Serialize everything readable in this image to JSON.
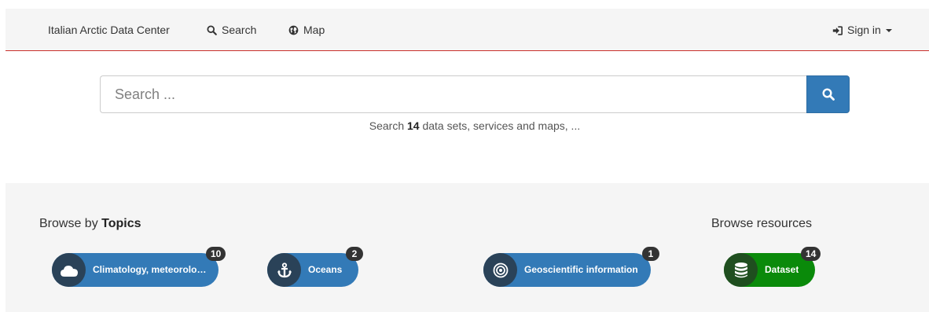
{
  "navbar": {
    "brand": "Italian Arctic Data Center",
    "search_label": "Search",
    "map_label": "Map",
    "signin_label": "Sign in"
  },
  "search": {
    "placeholder": "Search ...",
    "hint_prefix": "Search ",
    "hint_count": "14",
    "hint_suffix": " data sets, services and maps, ..."
  },
  "browse": {
    "topics_prefix": "Browse by ",
    "topics_bold": "Topics",
    "resources_title": "Browse resources",
    "topics": [
      {
        "label": "Climatology, meteorology, atmosphere",
        "count": "10",
        "icon": "cloud-icon"
      },
      {
        "label": "Oceans",
        "count": "2",
        "icon": "anchor-icon"
      },
      {
        "label": "Geoscientific information",
        "count": "1",
        "icon": "bullseye-icon"
      }
    ],
    "resources": [
      {
        "label": "Dataset",
        "count": "14",
        "icon": "database-icon"
      }
    ]
  },
  "colors": {
    "primary": "#337ab7",
    "success": "#0a8a0a",
    "navbar_bg": "#f5f5f5",
    "navbar_border": "#c9302c",
    "badge_bg": "#333333"
  }
}
